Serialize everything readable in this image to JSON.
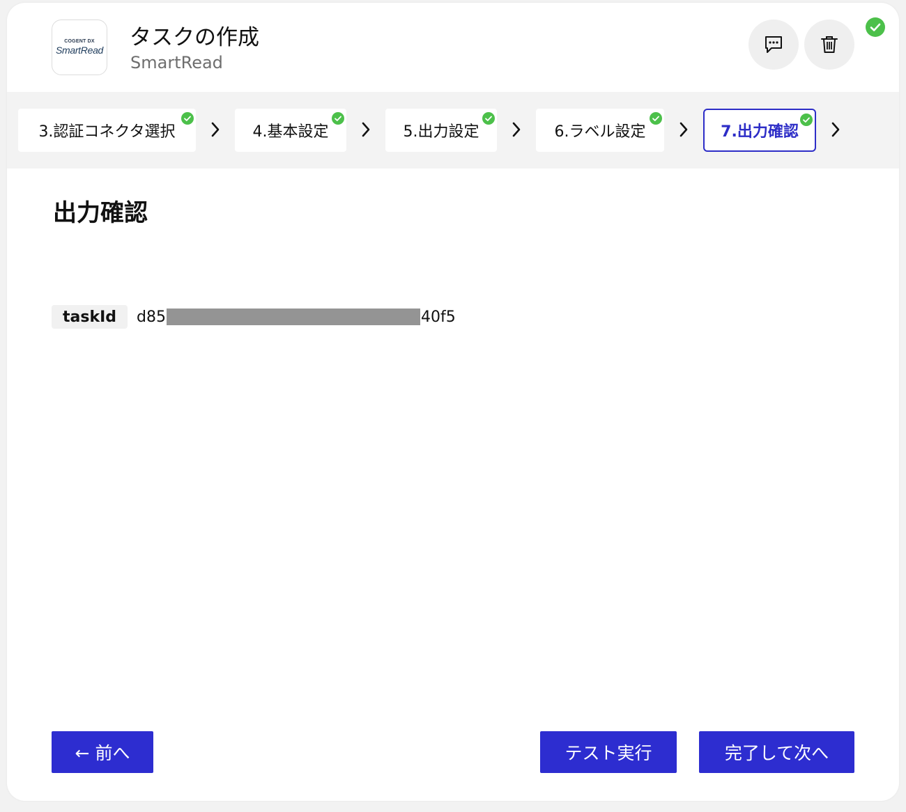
{
  "header": {
    "title": "タスクの作成",
    "subtitle": "SmartRead",
    "logo": {
      "small_text": "COGENT DX",
      "main_text": "SmartRead"
    },
    "icons": [
      "comment-icon",
      "trash-icon",
      "check-circle-icon"
    ]
  },
  "stepper": {
    "steps": [
      {
        "label": "3.認証コネクタ選択",
        "completed": true,
        "active": false
      },
      {
        "label": "4.基本設定",
        "completed": true,
        "active": false
      },
      {
        "label": "5.出力設定",
        "completed": true,
        "active": false
      },
      {
        "label": "6.ラベル設定",
        "completed": true,
        "active": false
      },
      {
        "label": "7.出力確認",
        "completed": true,
        "active": true
      }
    ]
  },
  "main": {
    "section_title": "出力確認",
    "field": {
      "key": "taskId",
      "value_prefix": "d85",
      "value_suffix": "40f5"
    }
  },
  "footer": {
    "prev_label": "← 前へ",
    "test_label": "テスト実行",
    "next_label": "完了して次へ"
  },
  "colors": {
    "primary": "#2d2dd0",
    "success": "#4cc04a",
    "stepper_bg": "#f3f3f3",
    "subtitle": "#6e6e6e"
  }
}
